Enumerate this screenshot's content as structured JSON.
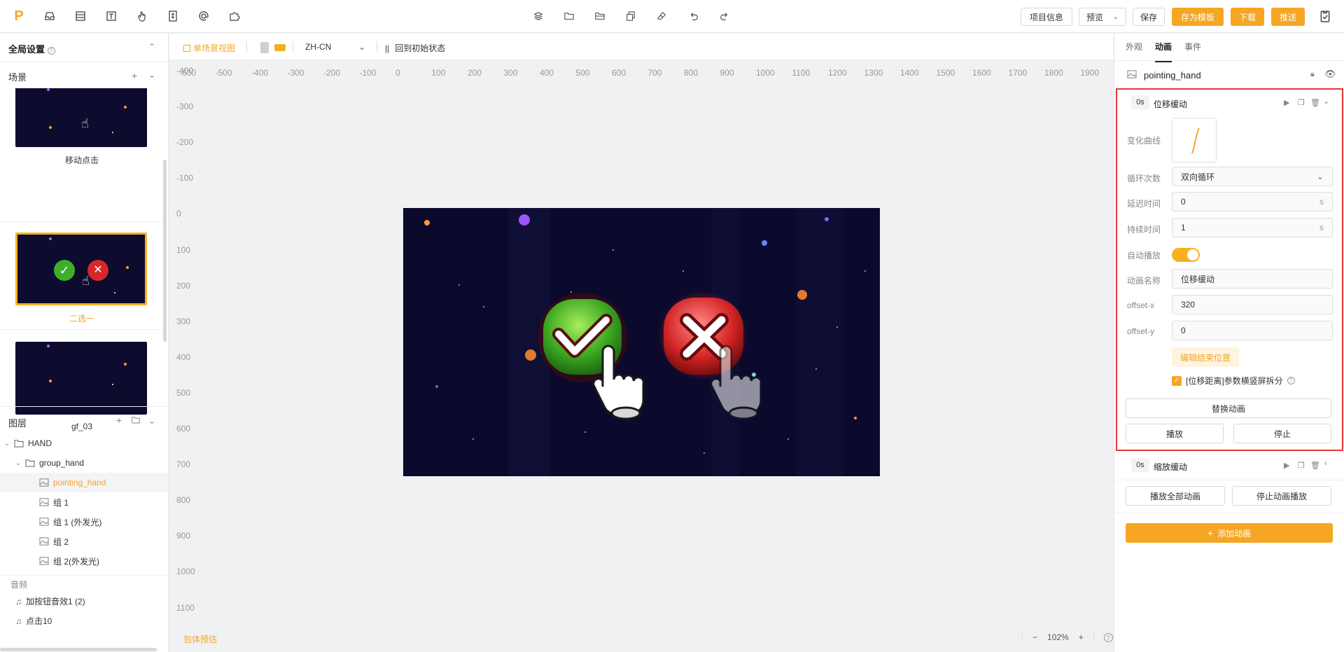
{
  "topbar": {
    "left_icons": [
      "inbox-icon",
      "list-icon",
      "text-icon",
      "hand-icon",
      "sort-icon",
      "at-icon",
      "puzzle-icon"
    ],
    "project_info": "项目信息",
    "preview": "预览",
    "save": "保存",
    "save_template": "存为模板",
    "download": "下载",
    "push": "推送",
    "accent": "#f5a623"
  },
  "left": {
    "global_settings": "全局设置",
    "scenes_title": "场景",
    "scenes": [
      {
        "name": "移动点击"
      },
      {
        "name": "二选一"
      },
      {
        "name": "gf_03"
      }
    ],
    "layers_title": "图层",
    "layers": [
      {
        "label": "HAND"
      },
      {
        "label": "group_hand"
      },
      {
        "label": "pointing_hand"
      },
      {
        "label": "组 1"
      },
      {
        "label": "组 1 (外发光)"
      },
      {
        "label": "组 2"
      },
      {
        "label": "组 2(外发光)"
      }
    ],
    "audio_title": "音频",
    "audio": [
      {
        "label": "加按钮音效1 (2)"
      },
      {
        "label": "点击10"
      }
    ]
  },
  "canvas": {
    "view_label": "单场景视图",
    "lang": "ZH-CN",
    "reset_label": "回到初始状态",
    "h_ticks": [
      "-600",
      "-500",
      "-400",
      "-300",
      "-200",
      "-100",
      "0",
      "100",
      "200",
      "300",
      "400",
      "500",
      "600",
      "700",
      "800",
      "900",
      "1000",
      "1100",
      "1200",
      "1300",
      "1400",
      "1500",
      "1600",
      "1700",
      "1800",
      "1900"
    ],
    "v_ticks": [
      "-400",
      "-300",
      "-200",
      "-100",
      "0",
      "100",
      "200",
      "300",
      "400",
      "500",
      "600",
      "700",
      "800",
      "900",
      "1000",
      "1100"
    ],
    "pkg_estimate": "包体预估",
    "zoom": "102%"
  },
  "right": {
    "tabs": [
      "外观",
      "动画",
      "事件"
    ],
    "active_tab": "动画",
    "layer_name": "pointing_hand",
    "anim1": {
      "time": "0s",
      "name": "位移缓动",
      "curve_label": "变化曲线",
      "loop_label": "循环次数",
      "loop_value": "双向循环",
      "delay_label": "延迟时间",
      "delay_value": "0",
      "duration_label": "持续时间",
      "duration_value": "1",
      "unit": "s",
      "autoplay_label": "自动播放",
      "anim_name_label": "动画名称",
      "anim_name_value": "位移缓动",
      "offset_x_label": "offset-x",
      "offset_x_value": "320",
      "offset_y_label": "offset-y",
      "offset_y_value": "0",
      "edit_end_label": "编辑结束位置",
      "split_label": "[位移距离]参数横竖屏拆分",
      "replace_label": "替换动画",
      "play_label": "播放",
      "stop_label": "停止"
    },
    "anim2": {
      "time": "0s",
      "name": "缩放缓动"
    },
    "play_all": "播放全部动画",
    "stop_all": "停止动画播放",
    "add_anim": "添加动画"
  }
}
